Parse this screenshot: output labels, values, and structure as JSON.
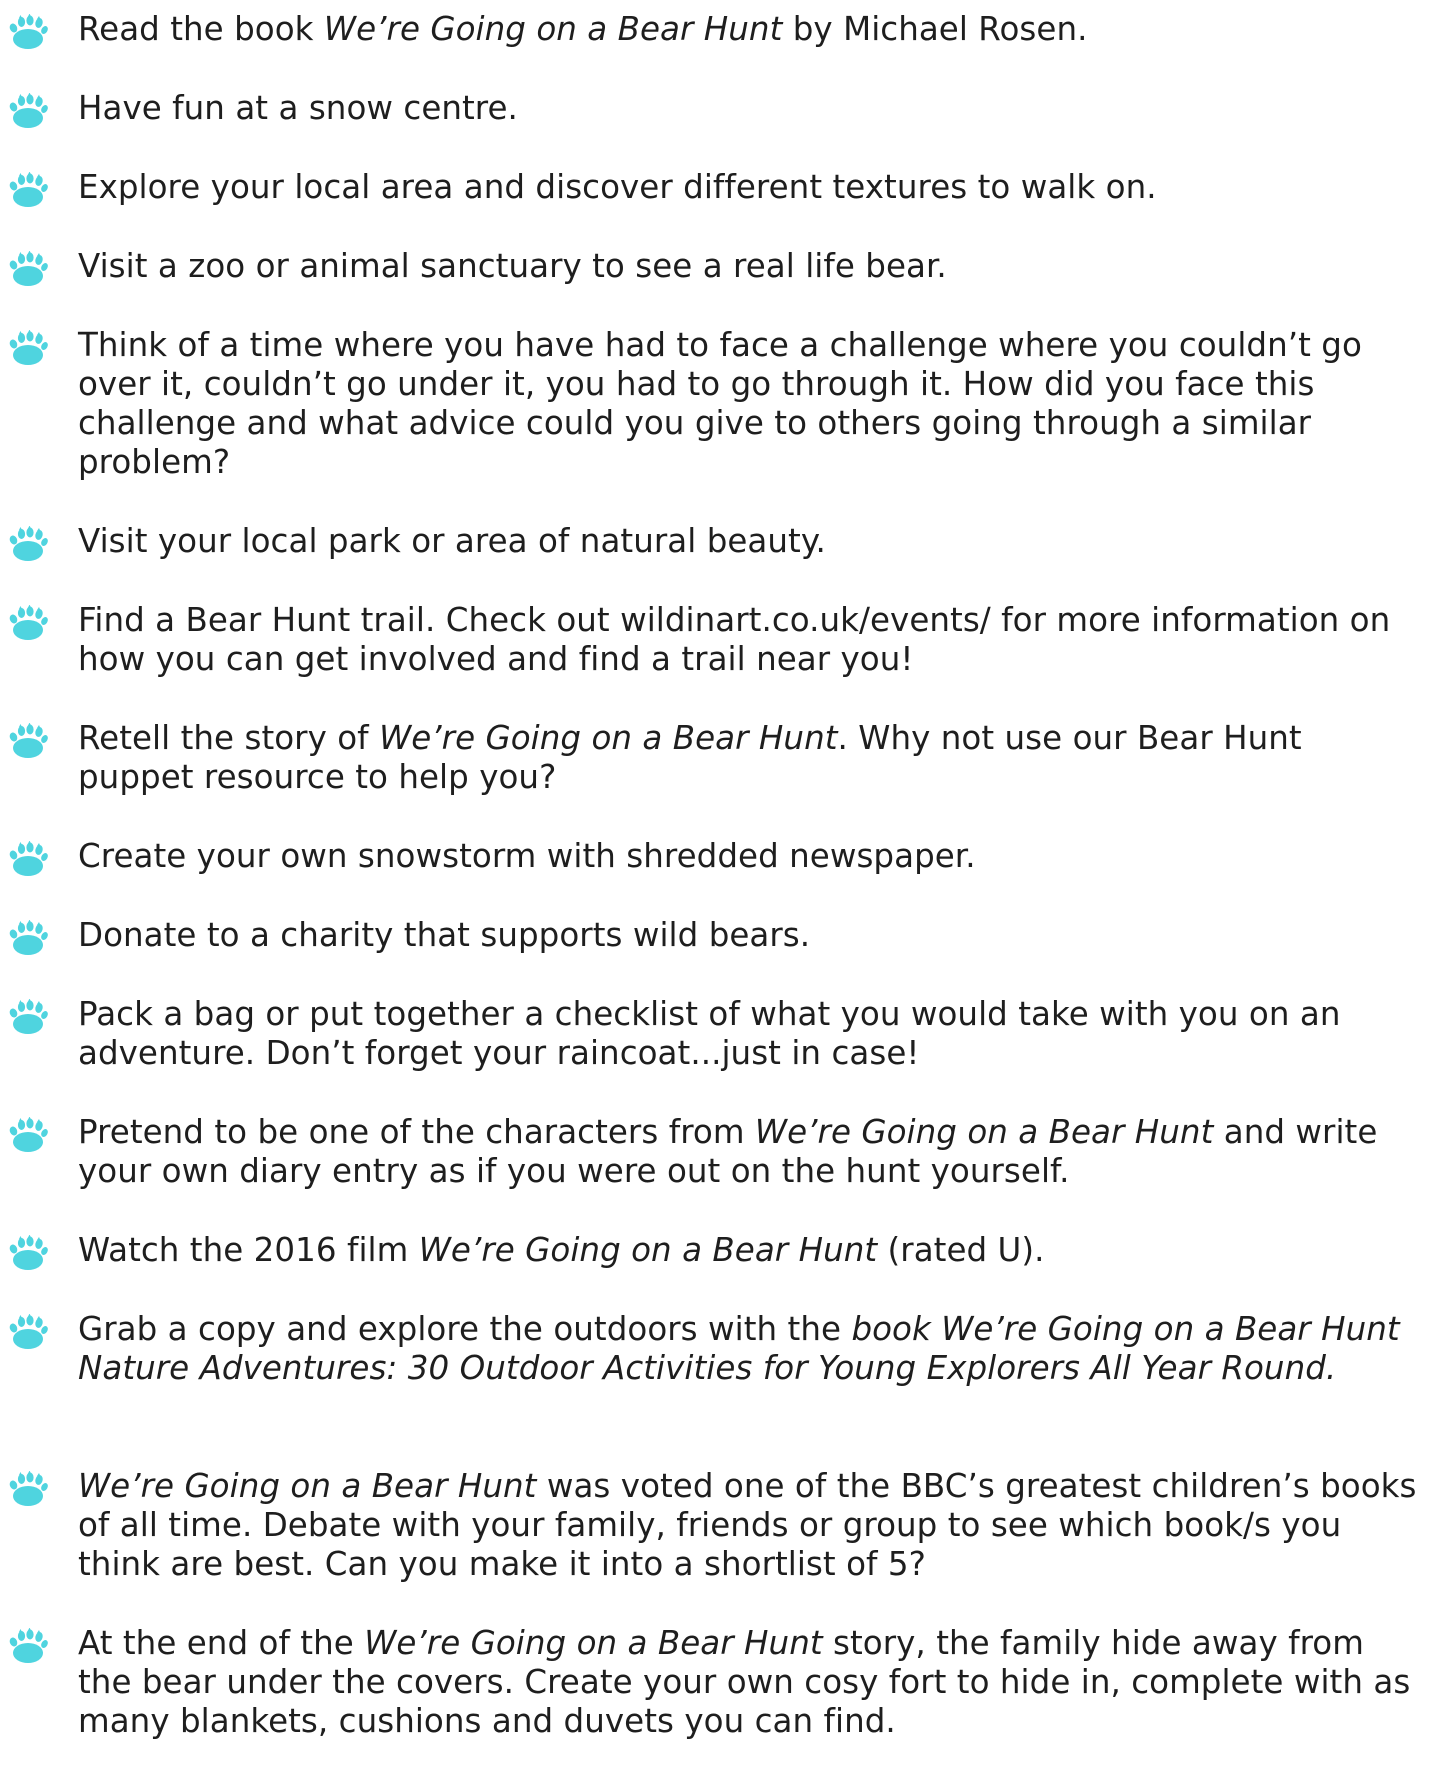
{
  "accent_color": "#4fd4df",
  "bullet_icon": "bear-paw-icon",
  "items": [
    {
      "segments": [
        {
          "text": "Read the book ",
          "italic": false
        },
        {
          "text": "We’re Going on a Bear Hunt",
          "italic": true
        },
        {
          "text": " by Michael Rosen.",
          "italic": false
        }
      ]
    },
    {
      "segments": [
        {
          "text": "Have fun at a snow centre.",
          "italic": false
        }
      ]
    },
    {
      "segments": [
        {
          "text": "Explore your local area and discover different textures to walk on.",
          "italic": false
        }
      ]
    },
    {
      "segments": [
        {
          "text": "Visit a zoo or animal sanctuary to see a real life bear.",
          "italic": false
        }
      ]
    },
    {
      "segments": [
        {
          "text": "Think of a time where you have had to face a challenge where you couldn’t go over it, couldn’t go under it, you had to go through it. How did you face this challenge and what advice could you give to others going through a similar problem?",
          "italic": false
        }
      ]
    },
    {
      "segments": [
        {
          "text": "Visit your local park or area of natural beauty.",
          "italic": false
        }
      ]
    },
    {
      "segments": [
        {
          "text": "Find a Bear Hunt trail. Check out wildinart.co.uk/events/ for more information on how you can get involved and find a trail near you!",
          "italic": false
        }
      ]
    },
    {
      "segments": [
        {
          "text": "Retell the story of ",
          "italic": false
        },
        {
          "text": "We’re Going on a Bear Hunt",
          "italic": true
        },
        {
          "text": ". Why not use our Bear Hunt puppet resource to help you?",
          "italic": false
        }
      ]
    },
    {
      "segments": [
        {
          "text": "Create your own snowstorm with shredded newspaper.",
          "italic": false
        }
      ]
    },
    {
      "segments": [
        {
          "text": "Donate to a charity that supports wild bears.",
          "italic": false
        }
      ]
    },
    {
      "segments": [
        {
          "text": "Pack a bag or put together a checklist of what you would take with you on an adventure. Don’t forget your raincoat...just in case!",
          "italic": false
        }
      ]
    },
    {
      "segments": [
        {
          "text": "Pretend to be one of the characters from ",
          "italic": false
        },
        {
          "text": "We’re Going on a Bear Hunt",
          "italic": true
        },
        {
          "text": " and write your own diary entry as if you were out on the hunt yourself.",
          "italic": false
        }
      ]
    },
    {
      "segments": [
        {
          "text": "Watch the 2016 film ",
          "italic": false
        },
        {
          "text": "We’re Going on a Bear Hunt",
          "italic": true
        },
        {
          "text": " (rated U).",
          "italic": false
        }
      ]
    },
    {
      "segments": [
        {
          "text": "Grab a copy and explore the outdoors with the ",
          "italic": false
        },
        {
          "text": "book We’re Going on a Bear Hunt Nature Adventures: 30 Outdoor Activities for Young Explorers All Year Round.",
          "italic": true
        }
      ]
    },
    {
      "segments": [
        {
          "text": "We’re Going on a Bear Hunt",
          "italic": true
        },
        {
          "text": " was voted one of the BBC’s greatest children’s books of all time. Debate with your family, friends or group to see which book/s you think are best. Can you make it into a shortlist of 5?",
          "italic": false
        }
      ]
    },
    {
      "segments": [
        {
          "text": "At the end of the ",
          "italic": false
        },
        {
          "text": "We’re Going on a Bear Hunt",
          "italic": true
        },
        {
          "text": " story, the family hide away from the bear under the covers. Create your own cosy fort to hide in, complete with as many blankets, cushions and duvets you can find.",
          "italic": false
        }
      ]
    }
  ]
}
